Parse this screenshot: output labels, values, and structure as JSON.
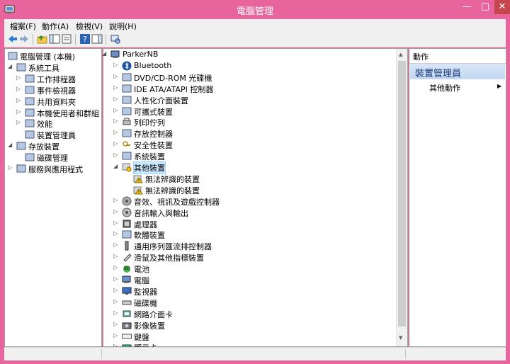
{
  "window": {
    "title": "電腦管理",
    "minimize": "—",
    "maximize": "□",
    "close": "✕"
  },
  "menu": [
    "檔案(F)",
    "動作(A)",
    "檢視(V)",
    "說明(H)"
  ],
  "left_tree": [
    {
      "label": "電腦管理 (本機)",
      "indent": 0,
      "exp": "",
      "icon": "computer-management-icon"
    },
    {
      "label": "系統工具",
      "indent": 1,
      "exp": "◢",
      "icon": "tools-icon"
    },
    {
      "label": "工作排程器",
      "indent": 2,
      "exp": "▷",
      "icon": "clock-icon"
    },
    {
      "label": "事件檢視器",
      "indent": 2,
      "exp": "▷",
      "icon": "event-viewer-icon"
    },
    {
      "label": "共用資料夾",
      "indent": 2,
      "exp": "▷",
      "icon": "shared-folder-icon"
    },
    {
      "label": "本機使用者和群組",
      "indent": 2,
      "exp": "▷",
      "icon": "users-icon"
    },
    {
      "label": "效能",
      "indent": 2,
      "exp": "▷",
      "icon": "performance-icon"
    },
    {
      "label": "裝置管理員",
      "indent": 2,
      "exp": "",
      "icon": "device-manager-icon"
    },
    {
      "label": "存放裝置",
      "indent": 1,
      "exp": "◢",
      "icon": "storage-icon"
    },
    {
      "label": "磁碟管理",
      "indent": 2,
      "exp": "",
      "icon": "disk-management-icon"
    },
    {
      "label": "服務與應用程式",
      "indent": 1,
      "exp": "▷",
      "icon": "services-icon"
    }
  ],
  "center_tree": [
    {
      "label": "ParkerNB",
      "indent": 0,
      "exp": "◢",
      "icon": "computer-icon"
    },
    {
      "label": "Bluetooth",
      "indent": 1,
      "exp": "▷",
      "icon": "bluetooth-icon"
    },
    {
      "label": "DVD/CD-ROM 光碟機",
      "indent": 1,
      "exp": "▷",
      "icon": "dvd-icon"
    },
    {
      "label": "IDE ATA/ATAPI 控制器",
      "indent": 1,
      "exp": "▷",
      "icon": "ide-controller-icon"
    },
    {
      "label": "人性化介面裝置",
      "indent": 1,
      "exp": "▷",
      "icon": "hid-icon"
    },
    {
      "label": "可攜式裝置",
      "indent": 1,
      "exp": "▷",
      "icon": "portable-device-icon"
    },
    {
      "label": "列印佇列",
      "indent": 1,
      "exp": "▷",
      "icon": "printer-icon"
    },
    {
      "label": "存放控制器",
      "indent": 1,
      "exp": "▷",
      "icon": "storage-controller-icon"
    },
    {
      "label": "安全性裝置",
      "indent": 1,
      "exp": "▷",
      "icon": "security-device-icon"
    },
    {
      "label": "系統裝置",
      "indent": 1,
      "exp": "▷",
      "icon": "system-device-icon"
    },
    {
      "label": "其他裝置",
      "indent": 1,
      "exp": "◢",
      "icon": "other-devices-icon",
      "selected": true
    },
    {
      "label": "無法辨識的裝置",
      "indent": 2,
      "exp": "",
      "icon": "unknown-device-warning-icon"
    },
    {
      "label": "無法辨識的裝置",
      "indent": 2,
      "exp": "",
      "icon": "unknown-device-warning-icon"
    },
    {
      "label": "音效、視訊及遊戲控制器",
      "indent": 1,
      "exp": "▷",
      "icon": "sound-icon"
    },
    {
      "label": "音訊輸入與輸出",
      "indent": 1,
      "exp": "▷",
      "icon": "audio-io-icon"
    },
    {
      "label": "處理器",
      "indent": 1,
      "exp": "▷",
      "icon": "processor-icon"
    },
    {
      "label": "軟體裝置",
      "indent": 1,
      "exp": "▷",
      "icon": "software-device-icon"
    },
    {
      "label": "通用序列匯流排控制器",
      "indent": 1,
      "exp": "▷",
      "icon": "usb-icon"
    },
    {
      "label": "滑鼠及其他指標裝置",
      "indent": 1,
      "exp": "▷",
      "icon": "mouse-icon"
    },
    {
      "label": "電池",
      "indent": 1,
      "exp": "▷",
      "icon": "battery-icon"
    },
    {
      "label": "電腦",
      "indent": 1,
      "exp": "▷",
      "icon": "computer-icon"
    },
    {
      "label": "監視器",
      "indent": 1,
      "exp": "▷",
      "icon": "monitor-icon"
    },
    {
      "label": "磁碟機",
      "indent": 1,
      "exp": "▷",
      "icon": "disk-drive-icon"
    },
    {
      "label": "網路介面卡",
      "indent": 1,
      "exp": "▷",
      "icon": "network-adapter-icon"
    },
    {
      "label": "影像裝置",
      "indent": 1,
      "exp": "▷",
      "icon": "imaging-device-icon"
    },
    {
      "label": "鍵盤",
      "indent": 1,
      "exp": "▷",
      "icon": "keyboard-icon"
    },
    {
      "label": "顯示卡",
      "indent": 1,
      "exp": "▷",
      "icon": "display-adapter-icon"
    }
  ],
  "actions": {
    "header": "動作",
    "section": "裝置管理員",
    "more": "其他動作"
  },
  "colors": {
    "frame": "#e8649c",
    "selection": "#cde8ff",
    "actions_section": "#c4d8f1"
  }
}
